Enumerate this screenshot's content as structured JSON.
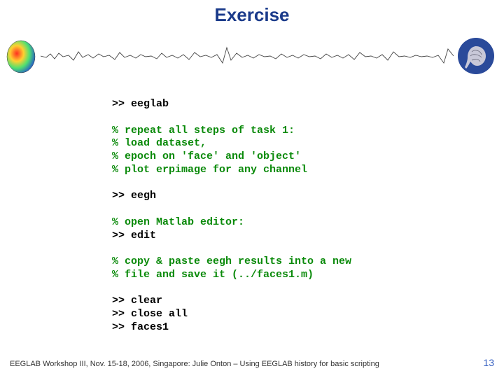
{
  "title": "Exercise",
  "code": {
    "l01": ">> eeglab",
    "l02": "",
    "l03": "% repeat all steps of task 1:",
    "l04": "% load dataset,",
    "l05": "% epoch on 'face' and 'object'",
    "l06": "% plot erpimage for any channel",
    "l07": "",
    "l08": ">> eegh",
    "l09": "",
    "l10": "% open Matlab editor:",
    "l11": ">> edit",
    "l12": "",
    "l13": "% copy & paste eegh results into a new",
    "l14": "% file and save it (../faces1.m)",
    "l15": "",
    "l16": ">> clear",
    "l17": ">> close all",
    "l18": ">> faces1"
  },
  "footer": {
    "text": "EEGLAB Workshop III, Nov. 15-18, 2006, Singapore: Julie Onton – Using EEGLAB history for basic scripting",
    "page": "13"
  },
  "icons": {
    "head": "head-topomap-icon",
    "brain": "sccn-brain-logo",
    "wave": "eeg-waveform"
  }
}
